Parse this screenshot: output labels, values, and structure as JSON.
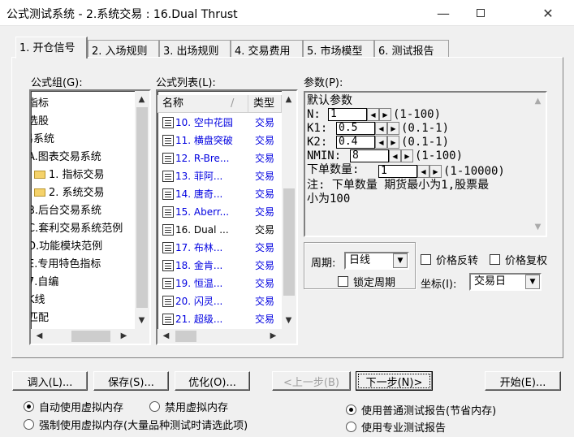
{
  "window": {
    "title": "公式测试系统 - 2.系统交易 : 16.Dual Thrust",
    "minimize_icon": "minimize-icon",
    "maximize_icon": "maximize-icon",
    "close_icon": "close-icon"
  },
  "tabs": [
    {
      "label": "1. 开仓信号"
    },
    {
      "label": "2. 入场规则"
    },
    {
      "label": "3. 出场规则"
    },
    {
      "label": "4. 交易费用"
    },
    {
      "label": "5. 市场模型"
    },
    {
      "label": "6. 测试报告"
    }
  ],
  "formula_group": {
    "label": "公式组(G):",
    "items": [
      "指标",
      "选股",
      "易系统",
      "A.图表交易系统",
      "1. 指标交易",
      "2. 系统交易",
      "B.后台交易系统",
      "C.套利交易系统范例",
      "D.功能模块范例",
      "E.专用特色指标",
      "7.自编",
      "K线",
      "匹配"
    ]
  },
  "formula_list": {
    "label": "公式列表(L):",
    "col_name": "名称",
    "col_type": "类型",
    "rows": [
      {
        "name": "10. 空中花园",
        "type": "交易",
        "highlight": true
      },
      {
        "name": "11. 横盘突破",
        "type": "交易",
        "highlight": true
      },
      {
        "name": "12. R-Bre...",
        "type": "交易",
        "highlight": true
      },
      {
        "name": "13. 菲阿...",
        "type": "交易",
        "highlight": true
      },
      {
        "name": "14. 唐奇...",
        "type": "交易",
        "highlight": true
      },
      {
        "name": "15. Aberr...",
        "type": "交易",
        "highlight": true
      },
      {
        "name": "16. Dual ...",
        "type": "交易",
        "highlight": false
      },
      {
        "name": "17. 布林...",
        "type": "交易",
        "highlight": true
      },
      {
        "name": "18. 金肯...",
        "type": "交易",
        "highlight": true
      },
      {
        "name": "19. 恒温...",
        "type": "交易",
        "highlight": true
      },
      {
        "name": "20. 闪灵...",
        "type": "交易",
        "highlight": true
      },
      {
        "name": "21. 超级...",
        "type": "交易",
        "highlight": true
      }
    ]
  },
  "params": {
    "label": "参数(P):",
    "header": "默认参数",
    "rows": [
      {
        "name": "N:",
        "value": "1",
        "range": "(1-100)"
      },
      {
        "name": "K1:",
        "value": "0.5",
        "range": "(0.1-1)"
      },
      {
        "name": "K2:",
        "value": "0.4",
        "range": "(0.1-1)"
      },
      {
        "name": "NMIN:",
        "value": "8",
        "range": "(1-100)"
      },
      {
        "name": "下单数量:",
        "value": "1",
        "range": "(1-10000)"
      }
    ],
    "note_line1": "注: 下单数量 期货最小为1,股票最",
    "note_line2": "小为100"
  },
  "period": {
    "label": "周期:",
    "value": "日线",
    "lock_label": "锁定周期"
  },
  "price_reverse_label": "价格反转",
  "price_adjust_label": "价格复权",
  "coord": {
    "label": "坐标(I):",
    "value": "交易日"
  },
  "buttons": {
    "import": "调入(L)...",
    "save": "保存(S)...",
    "optimize": "优化(O)...",
    "prev": "<上一步(B)",
    "next": "下一步(N)>",
    "start": "开始(E)..."
  },
  "options": {
    "auto_vmem": "自动使用虚拟内存",
    "disable_vmem": "禁用虚拟内存",
    "force_vmem": "强制使用虚拟内存(大量品种测试时请选此项)",
    "normal_report": "使用普通测试报告(节省内存)",
    "pro_report": "使用专业测试报告"
  }
}
